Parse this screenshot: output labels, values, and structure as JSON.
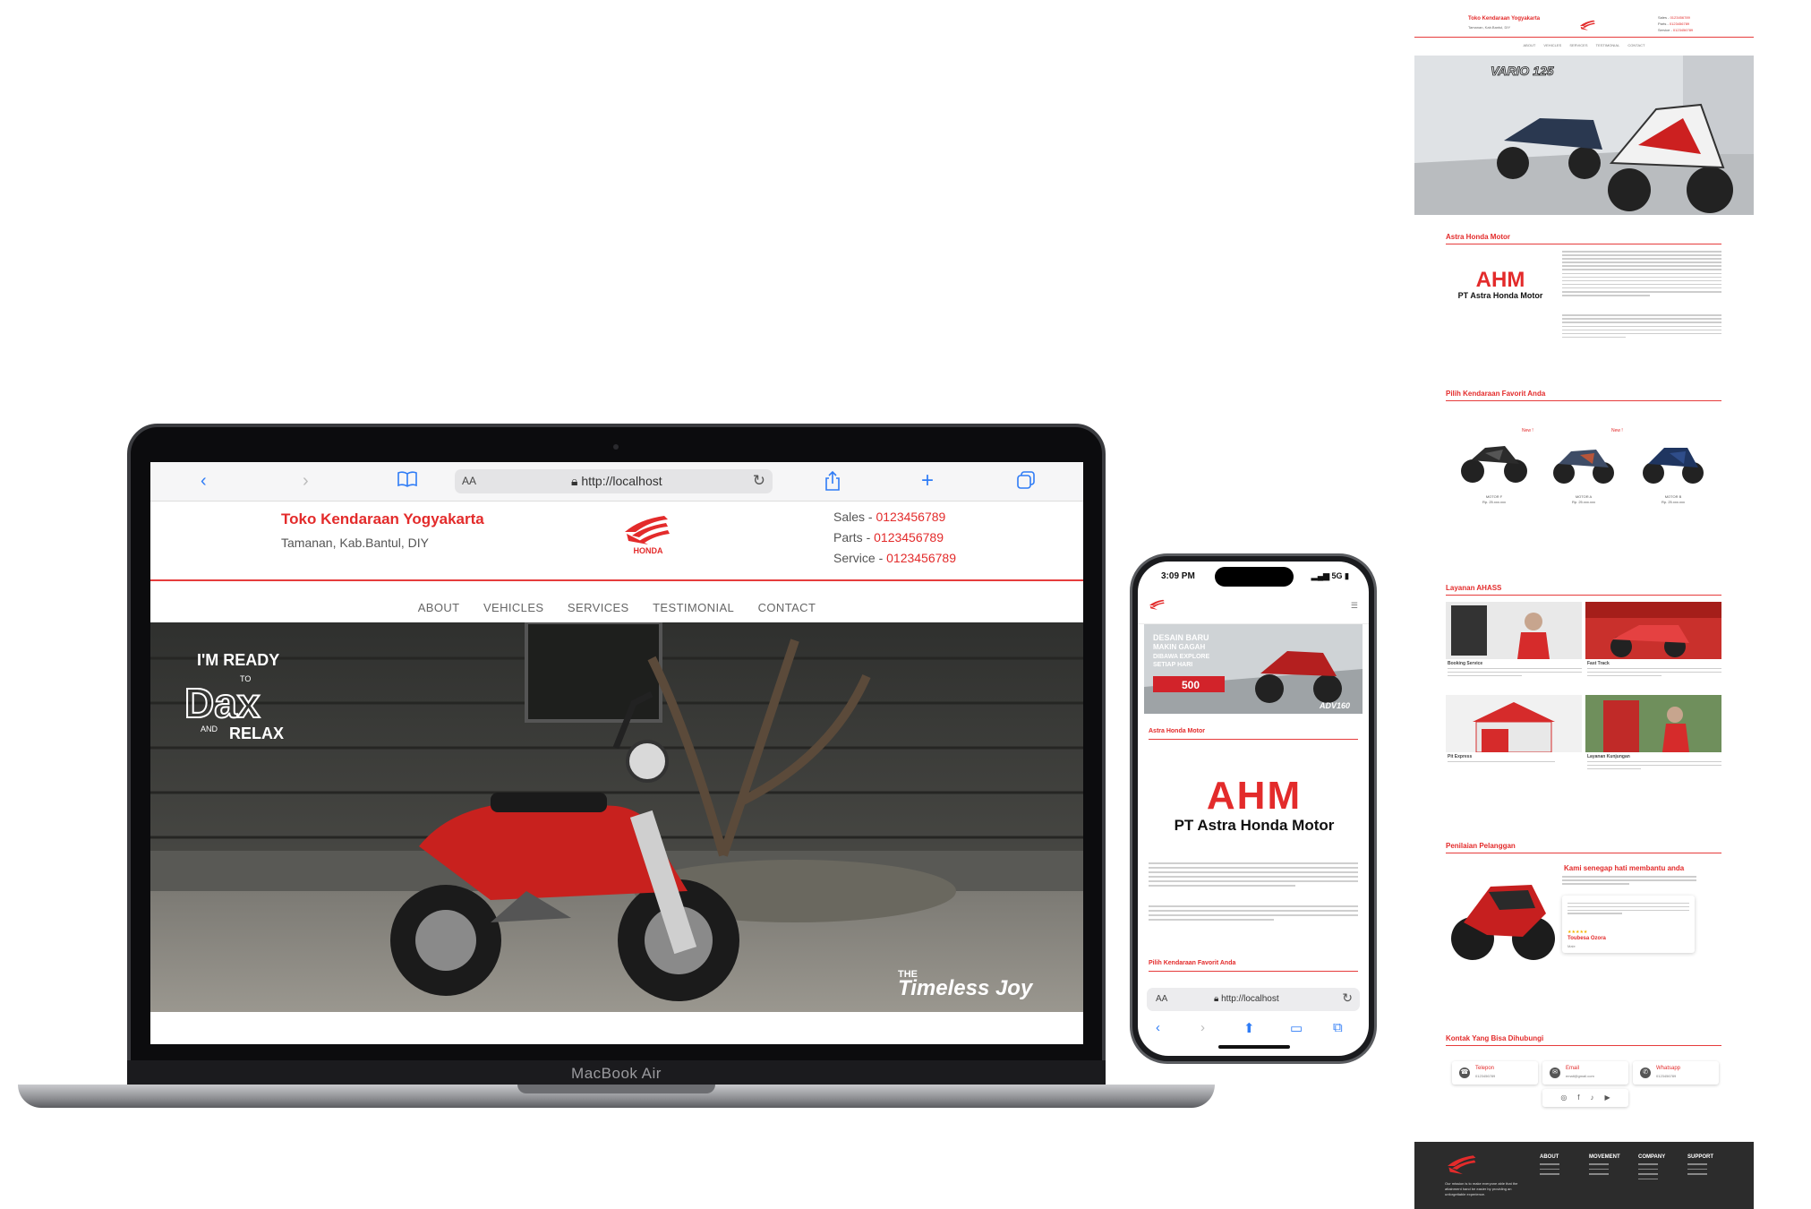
{
  "laptop": {
    "brand": "MacBook Air",
    "browser": {
      "text_size": "AA",
      "url": "http://localhost"
    }
  },
  "site": {
    "store_name": "Toko Kendaraan Yogyakarta",
    "store_address": "Tamanan, Kab.Bantul, DIY",
    "brand_logo_text": "HONDA",
    "contacts": [
      {
        "label": "Sales - ",
        "value": "0123456789"
      },
      {
        "label": "Parts - ",
        "value": "0123456789"
      },
      {
        "label": "Service - ",
        "value": "0123456789"
      }
    ],
    "nav": [
      "ABOUT",
      "VEHICLES",
      "SERVICES",
      "TESTIMONIAL",
      "CONTACT"
    ],
    "hero": {
      "line1": "I'M READY",
      "line2": "TO",
      "line3": "Dax",
      "line4": "AND",
      "line5": "RELAX",
      "tag1": "THE",
      "tag2": "Timeless Joy"
    }
  },
  "phone": {
    "time": "3:09 PM",
    "signal": "5G",
    "banner_line1": "DESAIN BARU",
    "banner_line2": "MAKIN GAGAH",
    "banner_line3": "DIBAWA EXPLORE",
    "banner_line4": "SETIAP HARI",
    "banner_price": "500",
    "banner_model": "ADV160",
    "section_about": "Astra Honda Motor",
    "section_vehicles": "Pilih Kendaraan Favorit Anda",
    "ahm_logo": "AHM",
    "ahm_name": "PT Astra Honda Motor",
    "browser": {
      "text_size": "AA",
      "url": "http://localhost"
    }
  },
  "preview": {
    "store_name": "Toko Kendaraan Yogyakarta",
    "store_address": "Tamanan, Kab.Bantul, DIY",
    "contacts": [
      {
        "label": "Sales - ",
        "value": "0123456789"
      },
      {
        "label": "Parts - ",
        "value": "0123456789"
      },
      {
        "label": "Service - ",
        "value": "0123456789"
      }
    ],
    "nav": [
      "ABOUT",
      "VEHICLES",
      "SERVICES",
      "TESTIMONIAL",
      "CONTACT"
    ],
    "hero_model": "VARIO 125",
    "section_about": "Astra Honda Motor",
    "ahm_logo": "AHM",
    "ahm_name": "PT Astra Honda Motor",
    "section_vehicles": "Pilih Kendaraan Favorit Anda",
    "motors": [
      {
        "name": "MOTOR F",
        "price": "Rp. 25.xxx.xxx",
        "badge": ""
      },
      {
        "name": "MOTOR A",
        "price": "Rp. 25.xxx.xxx",
        "badge": "New !"
      },
      {
        "name": "MOTOR B",
        "price": "Rp. 25.xxx.xxx",
        "badge": "New !"
      }
    ],
    "section_services": "Layanan AHASS",
    "services": [
      {
        "title": "Booking Service"
      },
      {
        "title": "Fast Track"
      },
      {
        "title": "Pit Express"
      },
      {
        "title": "Layanan Kunjungan"
      }
    ],
    "section_testimonial": "Penilaian Pelanggan",
    "testimonial_title": "Kami senegap hati membantu anda",
    "testimonial_stars": "★★★★★",
    "testimonial_name": "Toubesa Ozora",
    "testimonial_role": "Male",
    "section_contact": "Kontak Yang Bisa Dihubungi",
    "contacts_cards": [
      {
        "title": "Telepon",
        "value": "0123456789"
      },
      {
        "title": "Email",
        "value": "email@gmail.com"
      },
      {
        "title": "Whatsapp",
        "value": "0123456789"
      }
    ],
    "footer_mission": "Our mission is to make everyone able that the attainment hand be easier by providing an unforgettable experience.",
    "footer_cols": [
      "ABOUT",
      "MOVEMENT",
      "COMPANY",
      "SUPPORT"
    ]
  },
  "colors": {
    "brand_red": "#e32b2b",
    "link_blue": "#2f7cf6",
    "footer_dark": "#2c2c2c"
  }
}
